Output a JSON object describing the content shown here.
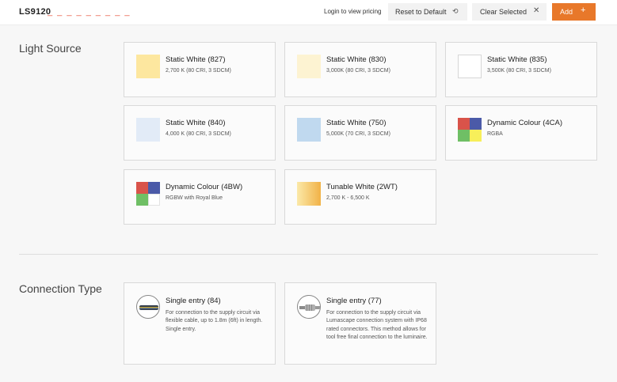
{
  "header": {
    "product_code": "LS9120",
    "code_placeholder": "_ _ _ _ _ _ _ _ _",
    "login_link": "Login to view pricing",
    "reset_label": "Reset to Default",
    "clear_label": "Clear Selected",
    "add_label": "Add"
  },
  "light_source": {
    "title": "Light Source",
    "options": [
      {
        "title": "Static White (827)",
        "subtitle": "2,700 K (80 CRI, 3 SDCM)",
        "swatch": "#fde79f"
      },
      {
        "title": "Static White (830)",
        "subtitle": "3,000K (80 CRI, 3 SDCM)",
        "swatch": "#fdf3d2"
      },
      {
        "title": "Static White (835)",
        "subtitle": "3,500K (80 CRI, 3 SDCM)",
        "swatch": "#ffffff"
      },
      {
        "title": "Static White (840)",
        "subtitle": "4,000 K (80 CRI, 3 SDCM)",
        "swatch": "#e2ebf7"
      },
      {
        "title": "Static White (750)",
        "subtitle": "5,000K (70 CRI, 3 SDCM)",
        "swatch": "#c0d9ef"
      },
      {
        "title": "Dynamic Colour (4CA)",
        "subtitle": "RGBA",
        "quad": [
          "#d9534a",
          "#4b5aa8",
          "#6fbf65",
          "#f7ef5a"
        ]
      },
      {
        "title": "Dynamic Colour (4BW)",
        "subtitle": "RGBW with Royal Blue",
        "quad": [
          "#d9534a",
          "#4b5aa8",
          "#6fbf65",
          "#ffffff"
        ]
      },
      {
        "title": "Tunable White (2WT)",
        "subtitle": "2,700 K - 6,500 K",
        "gradient": [
          "#fbe9a9",
          "#f1b247"
        ]
      }
    ]
  },
  "connection_type": {
    "title": "Connection Type",
    "options": [
      {
        "title": "Single entry (84)",
        "description": "For connection to the supply circuit via flexible cable, up to 1.8m (6ft) in length. Single entry.",
        "icon": "cable-icon"
      },
      {
        "title": "Single entry (77)",
        "description": "For connection to the supply circuit via Lumascape connection system with IP68 rated connectors. This method allows for tool free final connection to the luminaire.",
        "icon": "connector-icon"
      }
    ]
  },
  "icons": {
    "reset": "undo-icon",
    "clear": "close-icon",
    "add": "plus-icon"
  },
  "colors": {
    "accent": "#e8782a",
    "placeholder_dashes": "#e8553e"
  }
}
